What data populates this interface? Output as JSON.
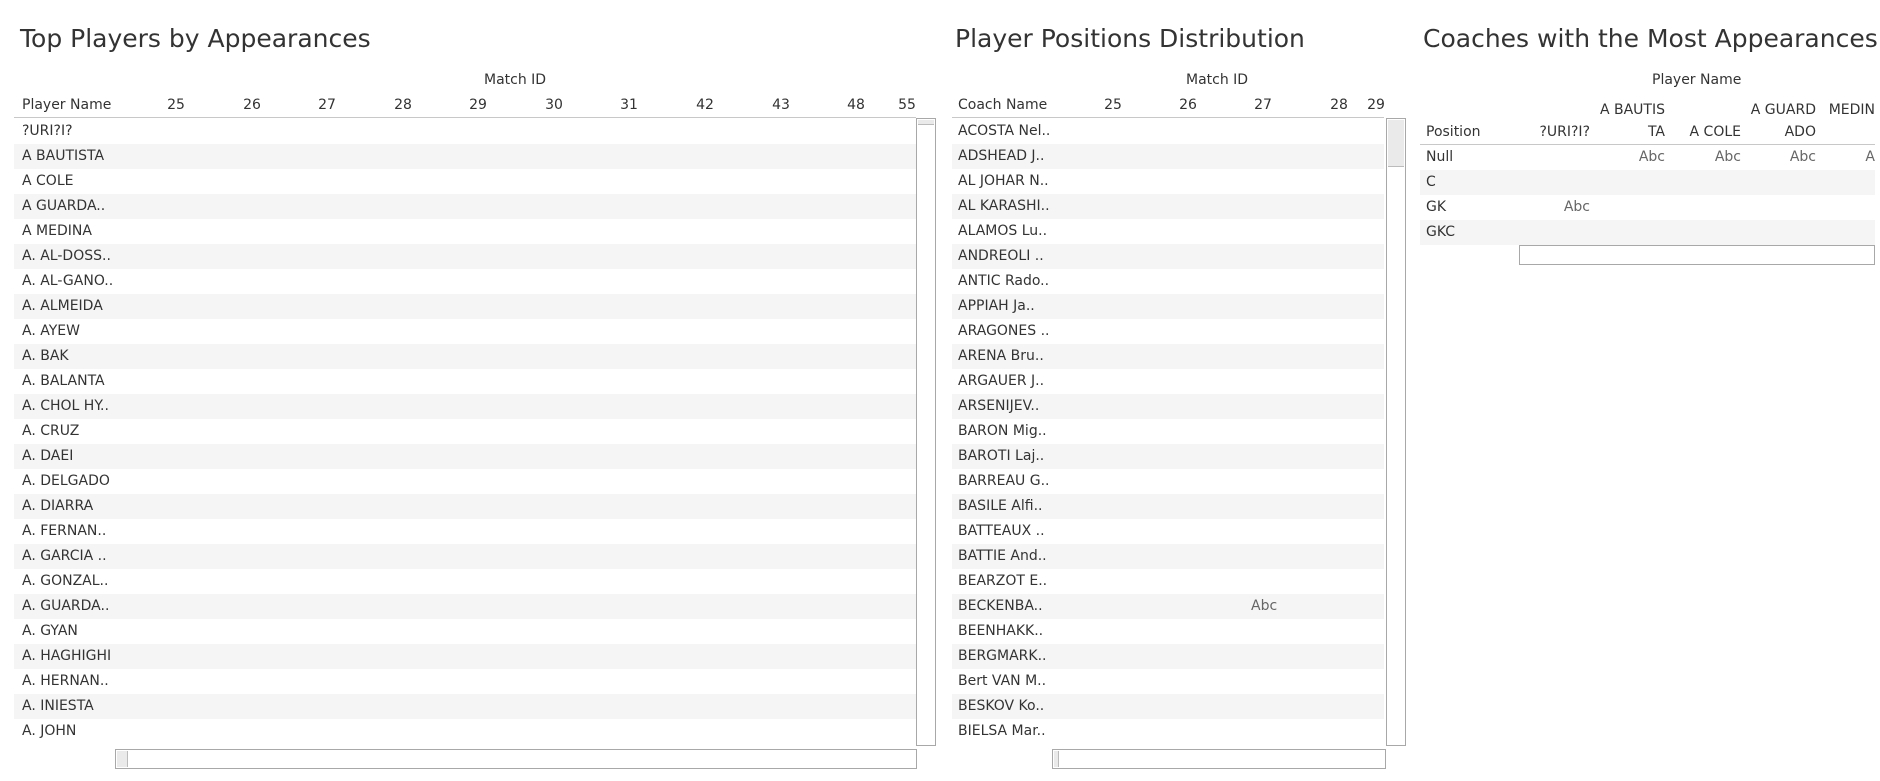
{
  "sheet1": {
    "title": "Top Players by Appearances",
    "axis_title": "Match ID",
    "row_header": "Player Name",
    "columns": [
      "25",
      "26",
      "27",
      "28",
      "29",
      "30",
      "31",
      "42",
      "43",
      "48",
      "55"
    ],
    "rows": [
      "?URI?I?",
      "A BAUTISTA",
      "A COLE",
      "A GUARDA..",
      "A MEDINA",
      "A. AL-DOSS..",
      "A. AL-GANO..",
      "A. ALMEIDA",
      "A. AYEW",
      "A. BAK",
      "A. BALANTA",
      "A. CHOL HY..",
      "A. CRUZ",
      "A. DAEI",
      "A. DELGADO",
      "A. DIARRA",
      "A. FERNAN..",
      "A. GARCIA ..",
      "A. GONZAL..",
      "A. GUARDA..",
      "A. GYAN",
      "A. HAGHIGHI",
      "A. HERNAN..",
      "A. INIESTA",
      "A. JOHN"
    ]
  },
  "sheet2": {
    "title": "Player Positions Distribution",
    "axis_title": "Match ID",
    "row_header": "Coach Name",
    "columns": [
      "25",
      "26",
      "27",
      "28",
      "29"
    ],
    "rows": [
      "ACOSTA Nel..",
      "ADSHEAD J..",
      "AL JOHAR N..",
      "AL KARASHI..",
      "ALAMOS Lu..",
      "ANDREOLI ..",
      "ANTIC Rado..",
      "APPIAH Ja..",
      "ARAGONES ..",
      "ARENA Bru..",
      "ARGAUER J..",
      "ARSENIJEV..",
      "BARON Mig..",
      "BAROTI Laj..",
      "BARREAU G..",
      "BASILE Alfi..",
      "BATTEAUX ..",
      "BATTIE And..",
      "BEARZOT E..",
      "BECKENBA..",
      "BEENHAKK..",
      "BERGMARK..",
      "Bert VAN M..",
      "BESKOV Ko..",
      "BIELSA Mar.."
    ],
    "cell_marks": [
      {
        "row": 19,
        "col": 2,
        "text": "Abc"
      }
    ]
  },
  "sheet3": {
    "title": "Coaches with the Most Appearances",
    "axis_title": "Player Name",
    "row_header": "Position",
    "columns": [
      {
        "line1": "",
        "line2": "?URI?I?"
      },
      {
        "line1": "A BAUTIS",
        "line2": "TA"
      },
      {
        "line1": "",
        "line2": "A COLE"
      },
      {
        "line1": "A GUARD",
        "line2": "ADO"
      },
      {
        "line1": "MEDIN",
        "line2": ""
      }
    ],
    "rows": [
      "Null",
      "C",
      "GK",
      "GKC"
    ],
    "cell_marks": [
      {
        "row": 0,
        "col": 1,
        "text": "Abc"
      },
      {
        "row": 0,
        "col": 2,
        "text": "Abc"
      },
      {
        "row": 0,
        "col": 3,
        "text": "Abc"
      },
      {
        "row": 0,
        "col": 4,
        "text": "A"
      },
      {
        "row": 2,
        "col": 0,
        "text": "Abc"
      }
    ]
  }
}
